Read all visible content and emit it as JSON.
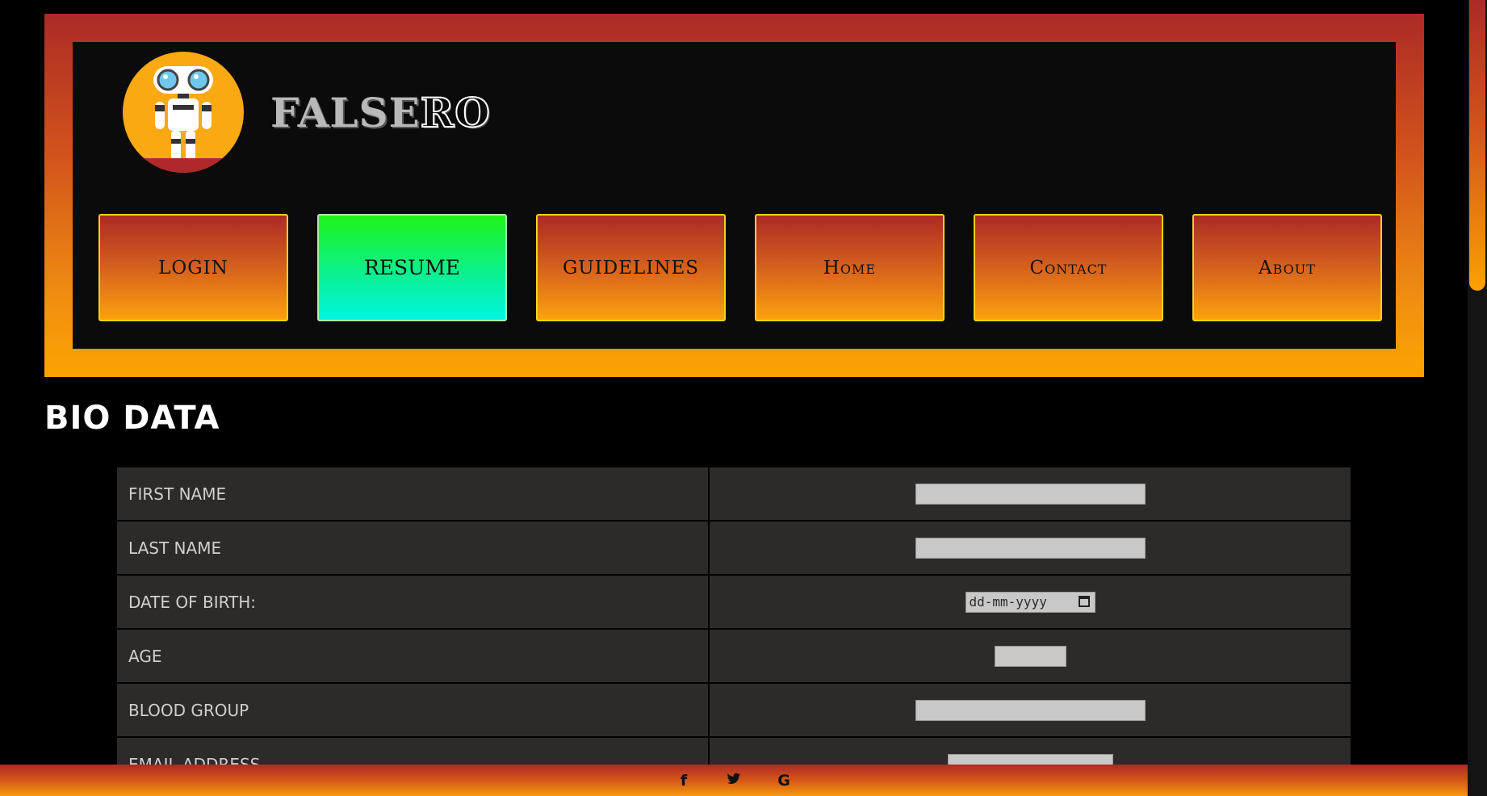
{
  "brand": {
    "name_part1": "FALSE",
    "name_part2": "RO",
    "logo_icon": "robot-icon"
  },
  "nav": {
    "items": [
      {
        "label": "LOGIN",
        "active": false
      },
      {
        "label": "RESUME",
        "active": true
      },
      {
        "label": "GUIDELINES",
        "active": false
      },
      {
        "label": "Home",
        "active": false
      },
      {
        "label": "Contact",
        "active": false
      },
      {
        "label": "About",
        "active": false
      }
    ]
  },
  "bio": {
    "title": "BIO DATA",
    "rows": [
      {
        "label": "FIRST NAME",
        "input_type": "text",
        "value": ""
      },
      {
        "label": "LAST NAME",
        "input_type": "text",
        "value": ""
      },
      {
        "label": "DATE OF BIRTH:",
        "input_type": "date",
        "placeholder": "dd-mm-yyyy"
      },
      {
        "label": "AGE",
        "input_type": "number",
        "value": ""
      },
      {
        "label": "BLOOD GROUP",
        "input_type": "text",
        "value": ""
      },
      {
        "label": "EMAIL ADDRESS",
        "input_type": "email",
        "value": ""
      }
    ]
  },
  "footer": {
    "icons": [
      {
        "name": "facebook-icon",
        "glyph": "f"
      },
      {
        "name": "twitter-icon",
        "glyph": "🐦"
      },
      {
        "name": "google-icon",
        "glyph": "G"
      }
    ]
  },
  "colors": {
    "header_gradient_top": "#ac2a26",
    "header_gradient_bottom": "#fca301",
    "active_nav_top": "#1ff319",
    "active_nav_bottom": "#00f4e2",
    "table_bg": "#2c2b2a",
    "page_bg": "#000000"
  }
}
